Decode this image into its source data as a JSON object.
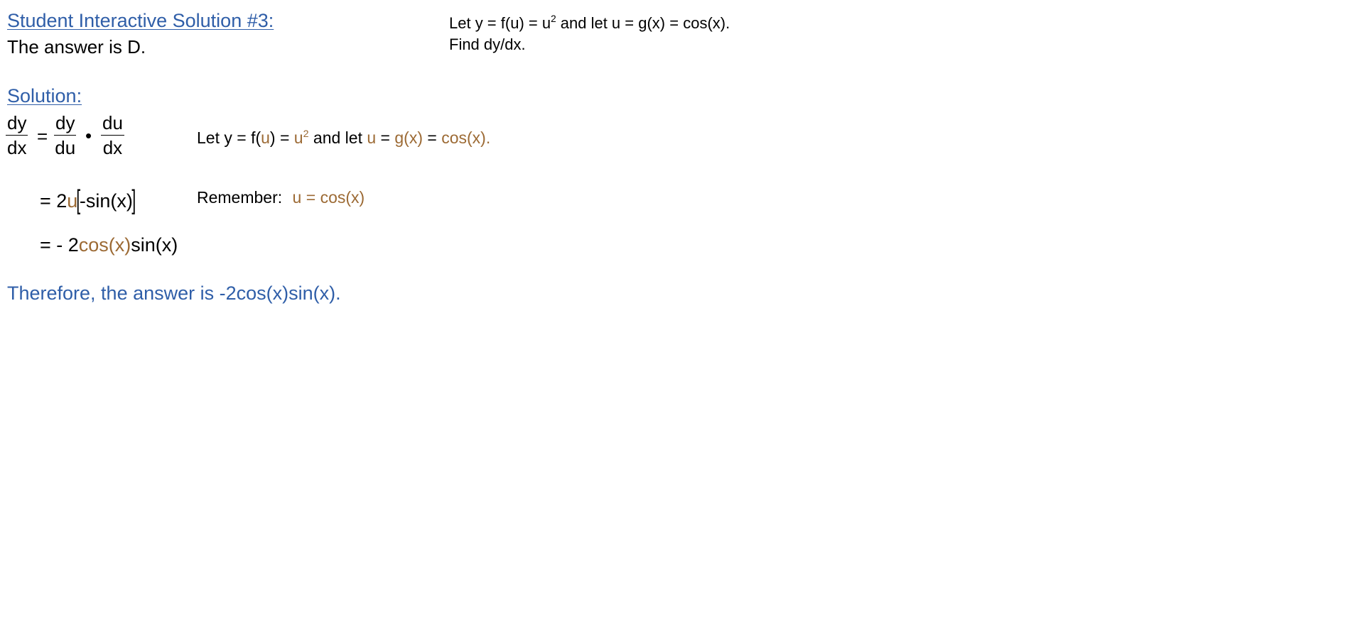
{
  "header": {
    "title": "Student Interactive Solution #3:",
    "answer": "The answer is D."
  },
  "problem": {
    "line1": {
      "prefix": "Let y = f(u) = u",
      "exp": "2",
      "suffix": " and let u = g(x) = cos(x)."
    },
    "line2": "Find dy/dx."
  },
  "solution": {
    "heading": "Solution:",
    "chain_rule": {
      "lhs_num": "dy",
      "lhs_den": "dx",
      "equals": "=",
      "f1_num": "dy",
      "f1_den": "du",
      "dot": "•",
      "f2_num": "du",
      "f2_den": "dx"
    },
    "given": {
      "p1": "Let y = f(",
      "u1": "u",
      "p2": ") = ",
      "u2": "u",
      "exp": "2",
      "p3": " and let ",
      "u3": "u",
      "p4": " = ",
      "gx": "g(x)",
      "p5": " = ",
      "cos": "cos(x)."
    },
    "step1": {
      "prefix": "= 2",
      "u": "u",
      "open": "[",
      "inner": "-sin(x)",
      "close": "]"
    },
    "remember": {
      "label": "Remember:",
      "u": "u",
      "eq": " = ",
      "cos": "cos(x)"
    },
    "step2": {
      "prefix": "= - 2",
      "cos": "cos(x)",
      "sin": "sin(x)"
    },
    "conclusion": "Therefore, the answer is -2cos(x)sin(x)."
  },
  "colors": {
    "link_blue": "#2f5ea8",
    "accent_brown": "#9c6a34",
    "text": "#000000"
  }
}
